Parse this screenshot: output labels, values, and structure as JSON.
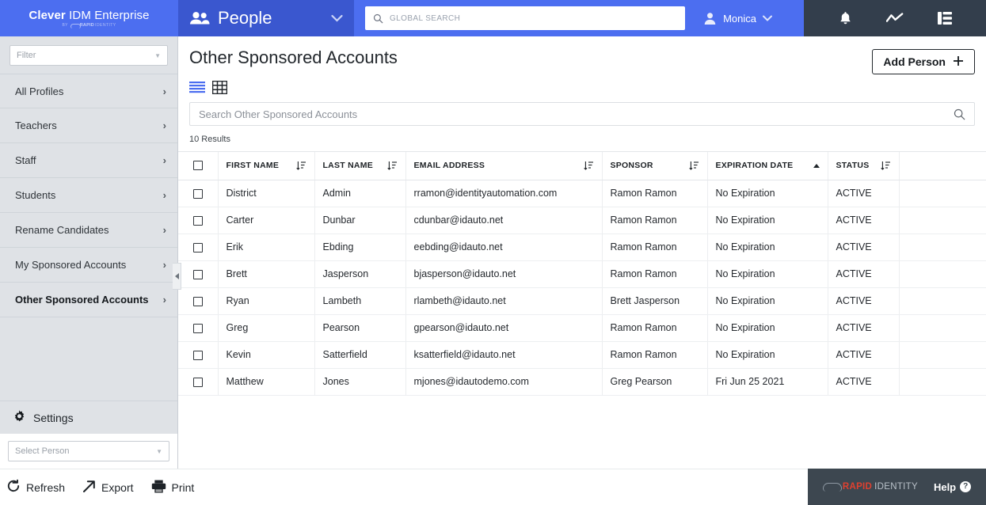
{
  "brand": {
    "name_bold": "Clever",
    "name_rest": " IDM Enterprise",
    "by": "BY",
    "rapid": "RAPID",
    "identity": "IDENTITY"
  },
  "topbar": {
    "section_label": "People",
    "people_icon": "people-icon",
    "chevron_icon": "chevron-down-icon",
    "global_search_placeholder": "GLOBAL SEARCH",
    "search_icon": "search-icon",
    "user_name": "Monica",
    "user_icon": "user-avatar-icon",
    "icons": [
      "bell-icon",
      "activity-chart-icon",
      "grid-list-icon"
    ]
  },
  "sidebar": {
    "filter_placeholder": "Filter",
    "items": [
      {
        "label": "All Profiles",
        "active": false
      },
      {
        "label": "Teachers",
        "active": false
      },
      {
        "label": "Staff",
        "active": false
      },
      {
        "label": "Students",
        "active": false
      },
      {
        "label": "Rename Candidates",
        "active": false
      },
      {
        "label": "My Sponsored Accounts",
        "active": false
      },
      {
        "label": "Other Sponsored Accounts",
        "active": true
      }
    ],
    "settings_label": "Settings",
    "settings_icon": "gear-icon",
    "select_person_placeholder": "Select Person",
    "collapse_icon": "collapse-left-icon"
  },
  "main": {
    "page_title": "Other Sponsored Accounts",
    "view_list_icon": "list-view-icon",
    "view_grid_icon": "grid-view-icon",
    "add_person_label": "Add Person",
    "add_person_icon": "plus-icon",
    "search_placeholder": "Search Other Sponsored Accounts",
    "search_icon": "search-icon",
    "results_count": "10 Results"
  },
  "table": {
    "columns": [
      {
        "label": "FIRST NAME",
        "sort": "sortable"
      },
      {
        "label": "LAST NAME",
        "sort": "sortable"
      },
      {
        "label": "EMAIL ADDRESS",
        "sort": "sortable"
      },
      {
        "label": "SPONSOR",
        "sort": "sortable"
      },
      {
        "label": "EXPIRATION DATE",
        "sort": "asc"
      },
      {
        "label": "STATUS",
        "sort": "sortable"
      }
    ],
    "rows": [
      {
        "first": "District",
        "last": "Admin",
        "email": "rramon@identityautomation.com",
        "sponsor": "Ramon Ramon",
        "expiration": "No Expiration",
        "status": "ACTIVE"
      },
      {
        "first": "Carter",
        "last": "Dunbar",
        "email": "cdunbar@idauto.net",
        "sponsor": "Ramon Ramon",
        "expiration": "No Expiration",
        "status": "ACTIVE"
      },
      {
        "first": "Erik",
        "last": "Ebding",
        "email": "eebding@idauto.net",
        "sponsor": "Ramon Ramon",
        "expiration": "No Expiration",
        "status": "ACTIVE"
      },
      {
        "first": "Brett",
        "last": "Jasperson",
        "email": "bjasperson@idauto.net",
        "sponsor": "Ramon Ramon",
        "expiration": "No Expiration",
        "status": "ACTIVE"
      },
      {
        "first": "Ryan",
        "last": "Lambeth",
        "email": "rlambeth@idauto.net",
        "sponsor": "Brett Jasperson",
        "expiration": "No Expiration",
        "status": "ACTIVE"
      },
      {
        "first": "Greg",
        "last": "Pearson",
        "email": "gpearson@idauto.net",
        "sponsor": "Ramon Ramon",
        "expiration": "No Expiration",
        "status": "ACTIVE"
      },
      {
        "first": "Kevin",
        "last": "Satterfield",
        "email": "ksatterfield@idauto.net",
        "sponsor": "Ramon Ramon",
        "expiration": "No Expiration",
        "status": "ACTIVE"
      },
      {
        "first": "Matthew",
        "last": "Jones",
        "email": "mjones@idautodemo.com",
        "sponsor": "Greg Pearson",
        "expiration": "Fri Jun 25 2021",
        "status": "ACTIVE"
      }
    ]
  },
  "footer": {
    "refresh_label": "Refresh",
    "refresh_icon": "refresh-icon",
    "export_label": "Export",
    "export_icon": "export-arrow-icon",
    "print_label": "Print",
    "print_icon": "printer-icon",
    "rapid": "RAPID",
    "identity": "IDENTITY",
    "help_label": "Help",
    "help_icon": "question-mark-icon"
  },
  "colors": {
    "brand_blue": "#4c6ef0",
    "section_blue": "#3a57cf",
    "dark_slate": "#333e4c",
    "footer_slate": "#3d4750",
    "sidebar_gray": "#dfe2e6",
    "accent_red": "#e0402f"
  }
}
